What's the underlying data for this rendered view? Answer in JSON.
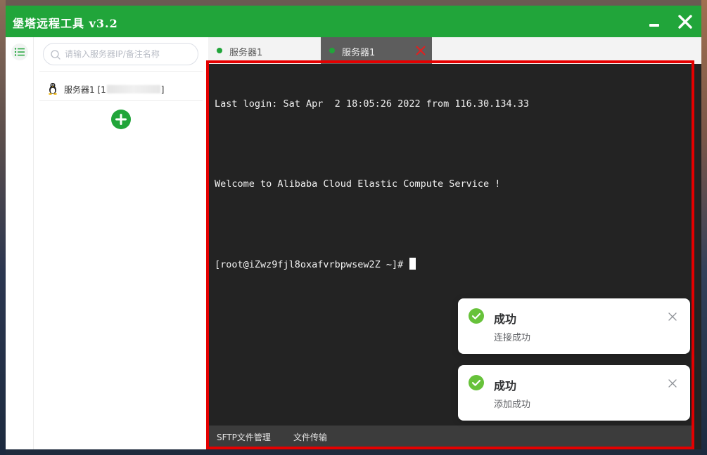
{
  "window": {
    "title": "堡塔远程工具 v3.2",
    "accent_color": "#21a53a"
  },
  "search": {
    "placeholder": "请输入服务器IP/备注名称"
  },
  "sidebar": {
    "server_label_prefix": "服务器1 [1",
    "server_label_suffix": "]",
    "server_os_icon": "linux-penguin-icon"
  },
  "tabs": [
    {
      "label": "服务器1",
      "status_color": "#21a53a"
    },
    {
      "label": "服务器1",
      "status_color": "#21a53a",
      "active": true
    }
  ],
  "terminal": {
    "lines": [
      "Last login: Sat Apr  2 18:05:26 2022 from 116.30.134.33",
      "",
      "Welcome to Alibaba Cloud Elastic Compute Service !",
      "",
      "[root@iZwz9fjl8oxafvrbpwsew2Z ~]# "
    ]
  },
  "bottom_bar": {
    "sftp_label": "SFTP文件管理",
    "transfer_label": "文件传输"
  },
  "toasts": [
    {
      "title": "成功",
      "message": "连接成功"
    },
    {
      "title": "成功",
      "message": "添加成功"
    }
  ],
  "colors": {
    "highlight_border": "#e50000",
    "terminal_bg": "#232323",
    "success_green": "#67c23a"
  }
}
